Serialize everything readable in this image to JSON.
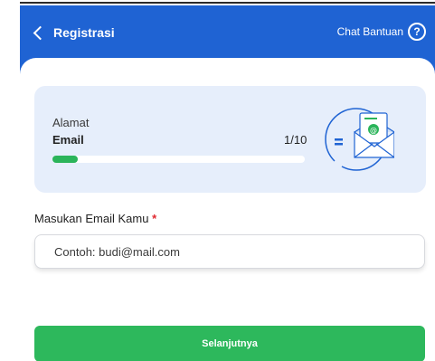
{
  "header": {
    "title": "Registrasi",
    "help_label": "Chat Bantuan",
    "help_icon": "question-circle-icon",
    "back_icon": "chevron-left-icon",
    "background_color": "#1f63d3"
  },
  "progress_card": {
    "label": "Alamat",
    "step_name": "Email",
    "step_counter": "1/10",
    "progress_fraction": 0.1,
    "progress_color": "#2bb45a",
    "illustration_icon": "email-envelope-icon"
  },
  "form": {
    "email_label": "Masukan Email Kamu",
    "required_mark": "*",
    "email_placeholder": "Contoh: budi@mail.com",
    "email_value": ""
  },
  "actions": {
    "next_label": "Selanjutnya",
    "next_color": "#2db85c"
  }
}
